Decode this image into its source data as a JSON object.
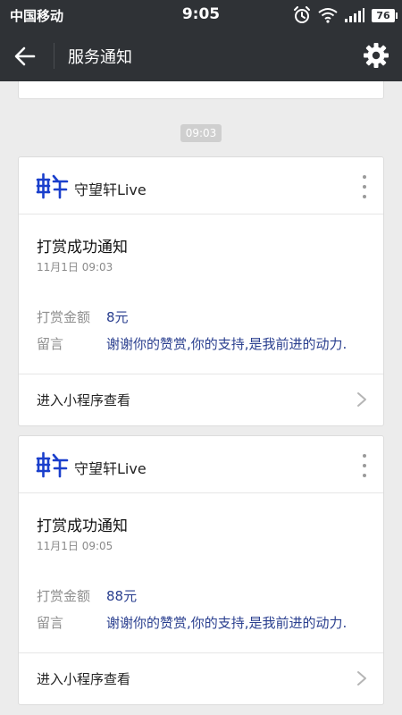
{
  "status_bar": {
    "carrier": "中国移动",
    "time": "9:05",
    "battery": "76",
    "icons": [
      "alarm-icon",
      "wifi-icon",
      "signal-icon",
      "battery-icon"
    ]
  },
  "nav": {
    "title": "服务通知",
    "back_icon": "back-arrow-icon",
    "settings_icon": "gear-icon"
  },
  "timestamp": "09:03",
  "notifications": [
    {
      "app_name": "守望轩Live",
      "title": "打赏成功通知",
      "date": "11月1日  09:03",
      "amount_label": "打赏金额",
      "amount": "8元",
      "message_label": "留言",
      "message": "谢谢你的赞赏,你的支持,是我前进的动力.",
      "action": "进入小程序查看"
    },
    {
      "app_name": "守望轩Live",
      "title": "打赏成功通知",
      "date": "11月1日  09:05",
      "amount_label": "打赏金额",
      "amount": "88元",
      "message_label": "留言",
      "message": "谢谢你的赞赏,你的支持,是我前进的动力.",
      "action": "进入小程序查看"
    }
  ],
  "colors": {
    "bar": "#2f3236",
    "background": "#ececec",
    "value_text": "#2a3f8f",
    "logo": "#1a3fcc"
  }
}
